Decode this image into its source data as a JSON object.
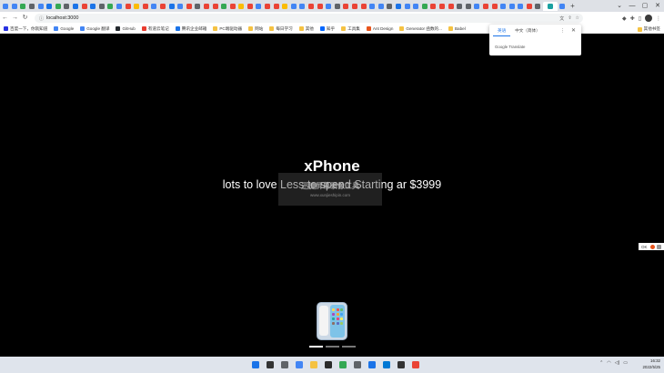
{
  "browser": {
    "tabs": [
      {
        "color": "#4285f4"
      },
      {
        "color": "#4285f4"
      },
      {
        "color": "#34a853"
      },
      {
        "color": "#5f6368"
      },
      {
        "color": "#4285f4"
      },
      {
        "color": "#1a73e8"
      },
      {
        "color": "#34a853"
      },
      {
        "color": "#5f6368"
      },
      {
        "color": "#1a73e8"
      },
      {
        "color": "#ea4335"
      },
      {
        "color": "#1a73e8"
      },
      {
        "color": "#5f6368"
      },
      {
        "color": "#34a853"
      },
      {
        "color": "#4285f4"
      },
      {
        "color": "#ea4335"
      },
      {
        "color": "#fbbc04"
      },
      {
        "color": "#ea4335"
      },
      {
        "color": "#4285f4"
      },
      {
        "color": "#ea4335"
      },
      {
        "color": "#1a73e8"
      },
      {
        "color": "#4285f4"
      },
      {
        "color": "#ea4335"
      },
      {
        "color": "#5f6368"
      },
      {
        "color": "#ea4335"
      },
      {
        "color": "#ea4335"
      },
      {
        "color": "#34a853"
      },
      {
        "color": "#ea4335"
      },
      {
        "color": "#fbbc04"
      },
      {
        "color": "#ea4335"
      },
      {
        "color": "#4285f4"
      },
      {
        "color": "#ea4335"
      },
      {
        "color": "#ea4335"
      },
      {
        "color": "#fbbc04"
      },
      {
        "color": "#4285f4"
      },
      {
        "color": "#4285f4"
      },
      {
        "color": "#ea4335"
      },
      {
        "color": "#ea4335"
      },
      {
        "color": "#4285f4"
      },
      {
        "color": "#5f6368"
      },
      {
        "color": "#ea4335"
      },
      {
        "color": "#ea4335"
      },
      {
        "color": "#ea4335"
      },
      {
        "color": "#4285f4"
      },
      {
        "color": "#4285f4"
      },
      {
        "color": "#5f6368"
      },
      {
        "color": "#1a73e8"
      },
      {
        "color": "#4285f4"
      },
      {
        "color": "#4285f4"
      },
      {
        "color": "#34a853"
      },
      {
        "color": "#ea4335"
      },
      {
        "color": "#ea4335"
      },
      {
        "color": "#ea4335"
      },
      {
        "color": "#5f6368"
      },
      {
        "color": "#5f6368"
      },
      {
        "color": "#4285f4"
      },
      {
        "color": "#ea4335"
      },
      {
        "color": "#ea4335"
      },
      {
        "color": "#4285f4"
      },
      {
        "color": "#4285f4"
      },
      {
        "color": "#4285f4"
      },
      {
        "color": "#ea4335"
      },
      {
        "color": "#5f6368"
      },
      {
        "color": "#1aa1a1",
        "active": true
      },
      {
        "color": "#4285f4"
      }
    ],
    "url": "localhost:3000",
    "bookmarks": [
      {
        "label": "百度一下，你就知道",
        "color": "#2932e1"
      },
      {
        "label": "Google",
        "color": "#4285f4"
      },
      {
        "label": "Google 翻译",
        "color": "#4285f4"
      },
      {
        "label": "GitHub",
        "color": "#24292e"
      },
      {
        "label": "有道云笔记",
        "color": "#e93c2f"
      },
      {
        "label": "腾讯企业邮箱",
        "color": "#1a73e8"
      },
      {
        "label": "PC端驱动器",
        "color": "#f5c242"
      },
      {
        "label": "网站",
        "color": "#f5c242"
      },
      {
        "label": "每日学习",
        "color": "#f5c242"
      },
      {
        "label": "其他",
        "color": "#f5c242"
      },
      {
        "label": "知乎",
        "color": "#0066ff"
      },
      {
        "label": "工具集",
        "color": "#f5c242"
      },
      {
        "label": "Ant Design",
        "color": "#e8541c"
      },
      {
        "label": "Generator 函数的...",
        "color": "#f5c242"
      },
      {
        "label": "Babel",
        "color": "#f5c242"
      }
    ],
    "other_bookmarks": "其他书签"
  },
  "translate_popup": {
    "tab_source": "英语",
    "tab_target": "中文（简体）",
    "brand": "Google Translate"
  },
  "page": {
    "title": "xPhone",
    "subtitle": "lots to love Less to spend Starting ar $3999",
    "watermark_top": "迅捷屏幕录像工具",
    "watermark_bottom": "www.xunjieshipin.com",
    "carousel_slide_count": 3,
    "carousel_active_index": 0
  },
  "side_extension": {
    "ok": "OK"
  },
  "taskbar": {
    "apps": [
      {
        "name": "start",
        "color": "#1a73e8"
      },
      {
        "name": "search",
        "color": "#333333"
      },
      {
        "name": "task-view",
        "color": "#5f6368"
      },
      {
        "name": "widgets",
        "color": "#4285f4"
      },
      {
        "name": "file-explorer",
        "color": "#f5c242"
      },
      {
        "name": "terminal",
        "color": "#2b2b2b"
      },
      {
        "name": "chrome",
        "color": "#34a853"
      },
      {
        "name": "settings",
        "color": "#5f6368"
      },
      {
        "name": "app-blue",
        "color": "#1a73e8"
      },
      {
        "name": "vscode",
        "color": "#0078d4"
      },
      {
        "name": "app-dark",
        "color": "#333333"
      },
      {
        "name": "recorder",
        "color": "#ea4335"
      }
    ],
    "time": "16:32",
    "date": "2022/5/25"
  }
}
